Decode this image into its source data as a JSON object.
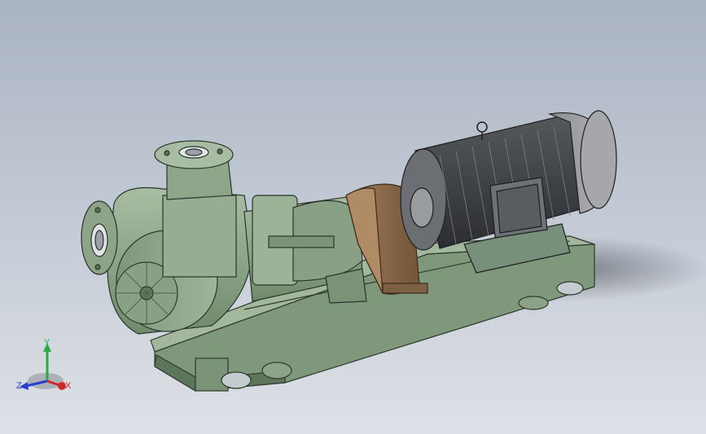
{
  "viewport": {
    "background_top": "#aab3c1",
    "background_bottom": "#dde1e6"
  },
  "model": {
    "components": [
      "base-frame",
      "pump-casing",
      "inlet-flange",
      "outlet-flange",
      "bearing-bracket",
      "coupling-guard",
      "electric-motor",
      "lifting-eye",
      "terminal-box"
    ],
    "colors": {
      "pump_green": "#8fa58a",
      "pump_green_dark": "#5f7a5c",
      "guard_brown": "#8b6a4a",
      "motor_dark": "#3d3f42",
      "motor_light": "#9a9c9f"
    }
  },
  "triad": {
    "x_label": "X",
    "y_label": "Y",
    "z_label": "Z",
    "x_color": "#cc2a2a",
    "y_color": "#2fa84a",
    "z_color": "#2a3fcc"
  }
}
